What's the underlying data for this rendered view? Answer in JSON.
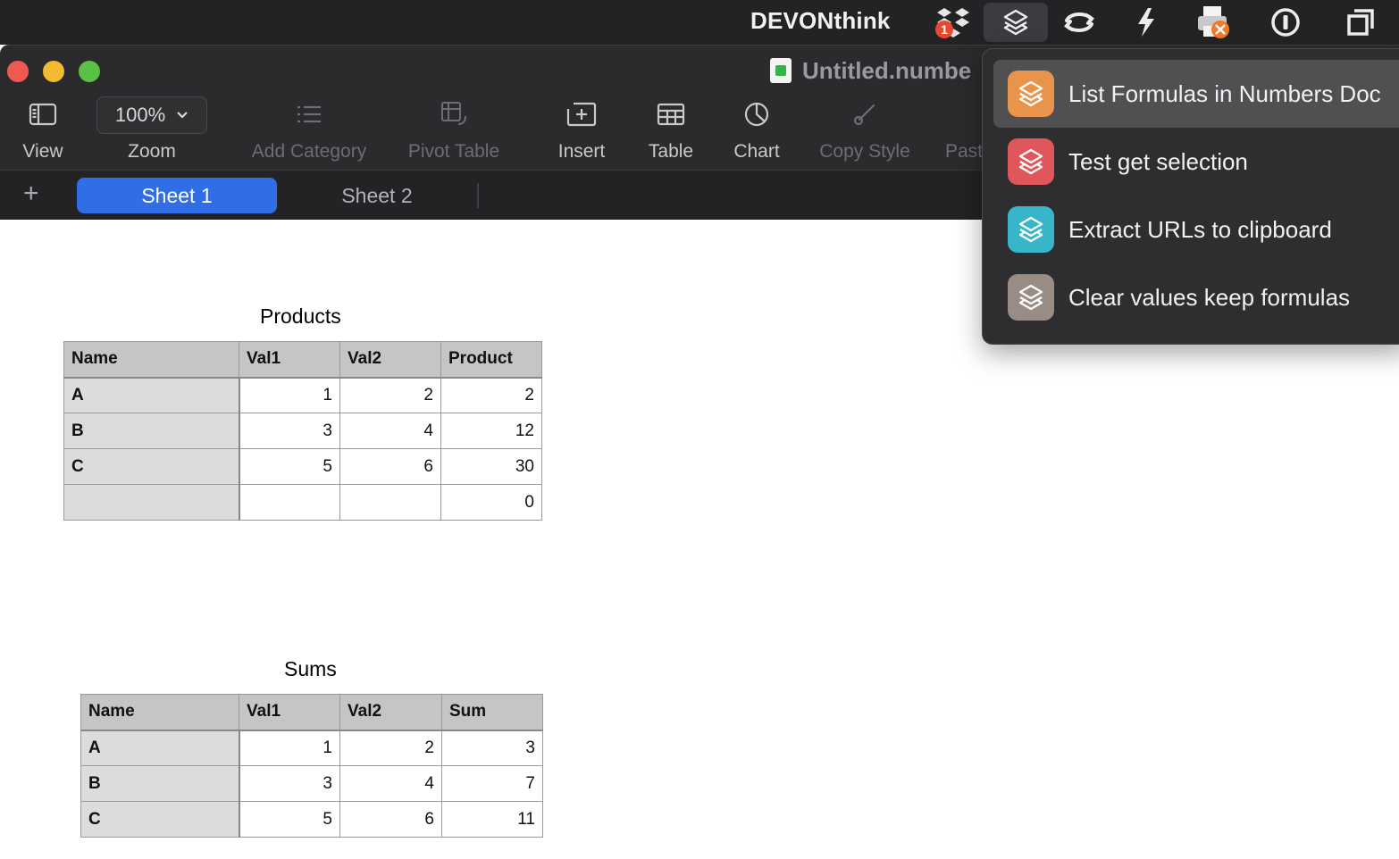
{
  "menubar": {
    "app_name": "DEVONthink",
    "dropbox_badge": "1",
    "icons": [
      "dropbox-icon",
      "shortcuts-icon",
      "sync-icon",
      "lightning-icon",
      "printer-icon",
      "info-icon",
      "window-icon"
    ]
  },
  "window": {
    "title": "Untitled.numbe",
    "toolbar": {
      "view": "View",
      "zoom_value": "100%",
      "zoom": "Zoom",
      "add_category": "Add Category",
      "pivot_table": "Pivot Table",
      "insert": "Insert",
      "table": "Table",
      "chart": "Chart",
      "copy_style": "Copy Style",
      "paste_style": "Past"
    },
    "tabs": [
      "Sheet 1",
      "Sheet 2"
    ],
    "add_sheet": "+"
  },
  "tables": {
    "products": {
      "title": "Products",
      "headers": [
        "Name",
        "Val1",
        "Val2",
        "Product"
      ],
      "rows": [
        [
          "A",
          "1",
          "2",
          "2"
        ],
        [
          "B",
          "3",
          "4",
          "12"
        ],
        [
          "C",
          "5",
          "6",
          "30"
        ],
        [
          "",
          "",
          "",
          "0"
        ]
      ]
    },
    "sums": {
      "title": "Sums",
      "headers": [
        "Name",
        "Val1",
        "Val2",
        "Sum"
      ],
      "rows": [
        [
          "A",
          "1",
          "2",
          "3"
        ],
        [
          "B",
          "3",
          "4",
          "7"
        ],
        [
          "C",
          "5",
          "6",
          "11"
        ]
      ]
    }
  },
  "shortcuts_menu": {
    "items": [
      {
        "label": "List Formulas in Numbers Doc",
        "color": "#e8944a"
      },
      {
        "label": "Test get selection",
        "color": "#e0575b"
      },
      {
        "label": "Extract URLs to clipboard",
        "color": "#37b6c9"
      },
      {
        "label": "Clear values keep formulas",
        "color": "#998c85"
      }
    ]
  }
}
